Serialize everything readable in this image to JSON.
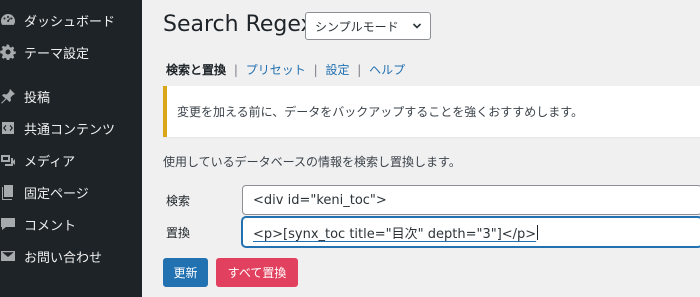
{
  "sidebar": {
    "items": [
      {
        "label": "ダッシュボード",
        "icon": "dashboard-icon"
      },
      {
        "label": "テーマ設定",
        "icon": "gear-icon"
      },
      {
        "label": "投稿",
        "icon": "pin-icon"
      },
      {
        "label": "共通コンテンツ",
        "icon": "code-icon"
      },
      {
        "label": "メディア",
        "icon": "media-icon"
      },
      {
        "label": "固定ページ",
        "icon": "pages-icon"
      },
      {
        "label": "コメント",
        "icon": "comment-icon"
      },
      {
        "label": "お問い合わせ",
        "icon": "mail-icon"
      }
    ]
  },
  "header": {
    "title": "Search Regex",
    "mode_select_value": "シンプルモード"
  },
  "subnav": {
    "current": "検索と置換",
    "links": [
      "プリセット",
      "設定",
      "ヘルプ"
    ]
  },
  "notice": {
    "text": "変更を加える前に、データをバックアップすることを強くおすすめします。"
  },
  "description": "使用しているデータベースの情報を検索し置換します。",
  "form": {
    "search_label": "検索",
    "search_value": "<div id=\"keni_toc\">",
    "replace_label": "置換",
    "replace_value": "<p>[synx_toc title=\"目次\" depth=\"3\"]</p>"
  },
  "buttons": {
    "update": "更新",
    "replace_all": "すべて置換"
  },
  "colors": {
    "sidebar_bg": "#1d2327",
    "primary": "#2271b1",
    "danger": "#e1415e",
    "notice_warning": "#dba617"
  }
}
